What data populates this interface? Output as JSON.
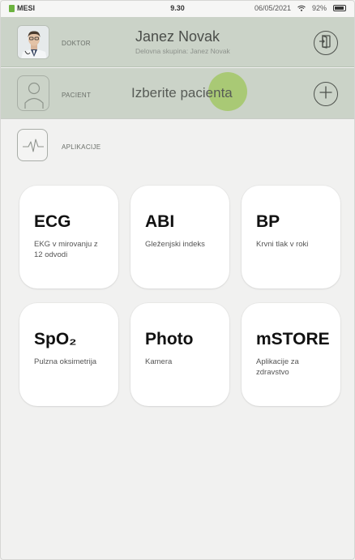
{
  "statusbar": {
    "brand": "MESI",
    "time": "9.30",
    "date": "06/05/2021",
    "battery": "92%"
  },
  "doctor": {
    "label": "DOKTOR",
    "name": "Janez Novak",
    "group": "Delovna skupina: Janez Novak",
    "logout_icon": "logout-icon"
  },
  "patient": {
    "label": "PACIENT",
    "placeholder": "Izberite pacienta",
    "add_icon": "plus-icon"
  },
  "apps": {
    "label": "APLIKACIJE",
    "icon": "pulse-icon"
  },
  "tiles": [
    {
      "title": "ECG",
      "subtitle": "EKG v mirovanju z 12 odvodi"
    },
    {
      "title": "ABI",
      "subtitle": "Gleženjski indeks"
    },
    {
      "title": "BP",
      "subtitle": "Krvni tlak v roki"
    },
    {
      "title": "SpO₂",
      "subtitle": "Pulzna oksimetrija"
    },
    {
      "title": "Photo",
      "subtitle": "Kamera"
    },
    {
      "title": "mSTORE",
      "subtitle": "Aplikacije za zdravstvo"
    }
  ],
  "colors": {
    "header_bg": "#cbd3c8",
    "page_bg": "#f1f1f0",
    "brand_green": "#6cb33f",
    "touch_indicator": "#9dc65a"
  }
}
